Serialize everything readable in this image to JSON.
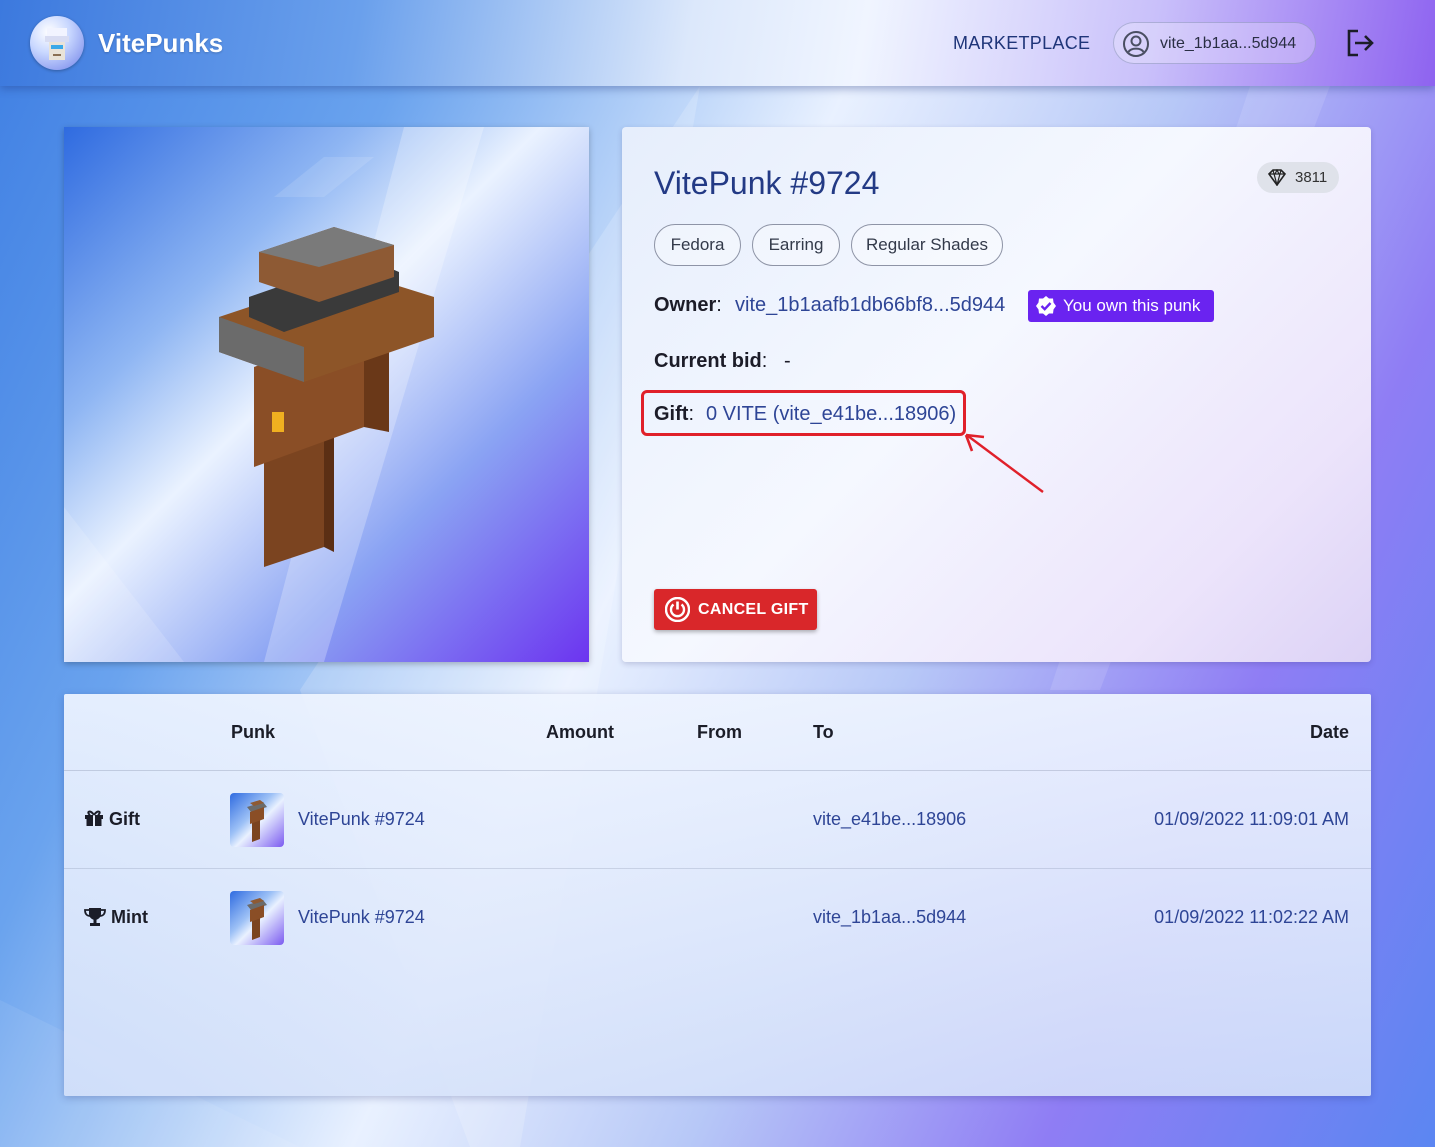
{
  "header": {
    "brand": "VitePunks",
    "nav_marketplace": "MARKETPLACE",
    "wallet_address": "vite_1b1aa...5d944"
  },
  "punk": {
    "title": "VitePunk #9724",
    "rank": "3811",
    "traits": [
      "Fedora",
      "Earring",
      "Regular Shades"
    ],
    "owner_label": "Owner",
    "owner_address": "vite_1b1aafb1db66bf8...5d944",
    "owned_badge": "You own this punk",
    "current_bid_label": "Current bid",
    "current_bid_value": "-",
    "gift_label": "Gift",
    "gift_value": "0 VITE (vite_e41be...18906)",
    "cancel_gift_label": "CANCEL GIFT",
    "separator": ":"
  },
  "history": {
    "columns": [
      "Punk",
      "Amount",
      "From",
      "To",
      "Date"
    ],
    "rows": [
      {
        "event": "Gift",
        "punk": "VitePunk #9724",
        "amount": "",
        "from": "",
        "to": "vite_e41be...18906",
        "date": "01/09/2022 11:09:01 AM"
      },
      {
        "event": "Mint",
        "punk": "VitePunk #9724",
        "amount": "",
        "from": "",
        "to": "vite_1b1aa...5d944",
        "date": "01/09/2022 11:02:22 AM"
      }
    ]
  },
  "colors": {
    "accent_purple": "#6a23f0",
    "danger_red": "#d9272a",
    "link_blue": "#2e4596",
    "annotation_red": "#e0202a"
  },
  "icons": {
    "logo": "punk-logo-icon",
    "wallet": "user-circle-icon",
    "logout": "logout-icon",
    "rank": "diamond-icon",
    "owned": "verified-check-icon",
    "cancel": "power-icon",
    "gift_event": "gift-icon",
    "mint_event": "trophy-icon"
  }
}
